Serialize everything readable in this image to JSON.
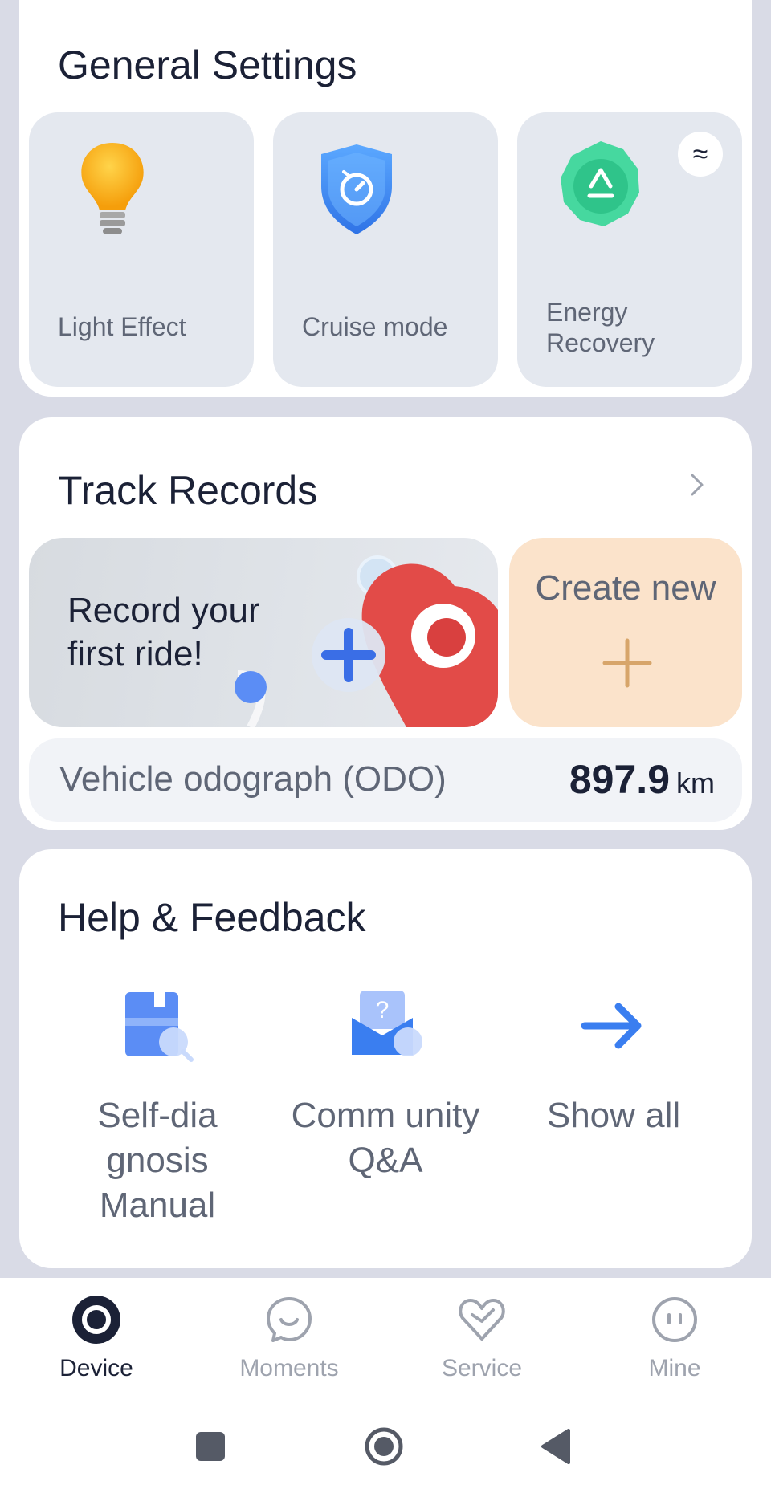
{
  "general_settings": {
    "title": "General Settings",
    "tiles": [
      {
        "label": "Light Effect",
        "icon": "lightbulb-icon"
      },
      {
        "label": "Cruise mode",
        "icon": "cruise-shield-icon"
      },
      {
        "label": "Energy Recovery",
        "icon": "energy-recovery-icon",
        "badge_icon": "waves-icon"
      }
    ]
  },
  "track_records": {
    "title": "Track Records",
    "banner_text": "Record your first ride!",
    "create_label": "Create new",
    "odo_label": "Vehicle odograph (ODO)",
    "odo_value": "897.9",
    "odo_unit": "km"
  },
  "help_feedback": {
    "title": "Help & Feedback",
    "items": [
      {
        "label": "Self-dia gnosis Manual",
        "icon": "manual-search-icon"
      },
      {
        "label": "Comm unity Q&A",
        "icon": "community-qa-icon"
      },
      {
        "label": "Show all",
        "icon": "arrow-right-icon"
      }
    ]
  },
  "bottom_nav": {
    "items": [
      {
        "label": "Device",
        "icon": "device-icon",
        "active": true
      },
      {
        "label": "Moments",
        "icon": "moments-chat-icon",
        "active": false
      },
      {
        "label": "Service",
        "icon": "service-heart-icon",
        "active": false
      },
      {
        "label": "Mine",
        "icon": "mine-face-icon",
        "active": false
      }
    ]
  },
  "system_nav": {
    "buttons": [
      "recents-icon",
      "home-icon",
      "back-icon"
    ]
  },
  "colors": {
    "accent_blue": "#3a7ef0",
    "energy_green": "#3fd7a0",
    "light_yellow": "#f7b21c",
    "create_bg": "#fbe3cb",
    "page_bg": "#d9dbe6"
  }
}
